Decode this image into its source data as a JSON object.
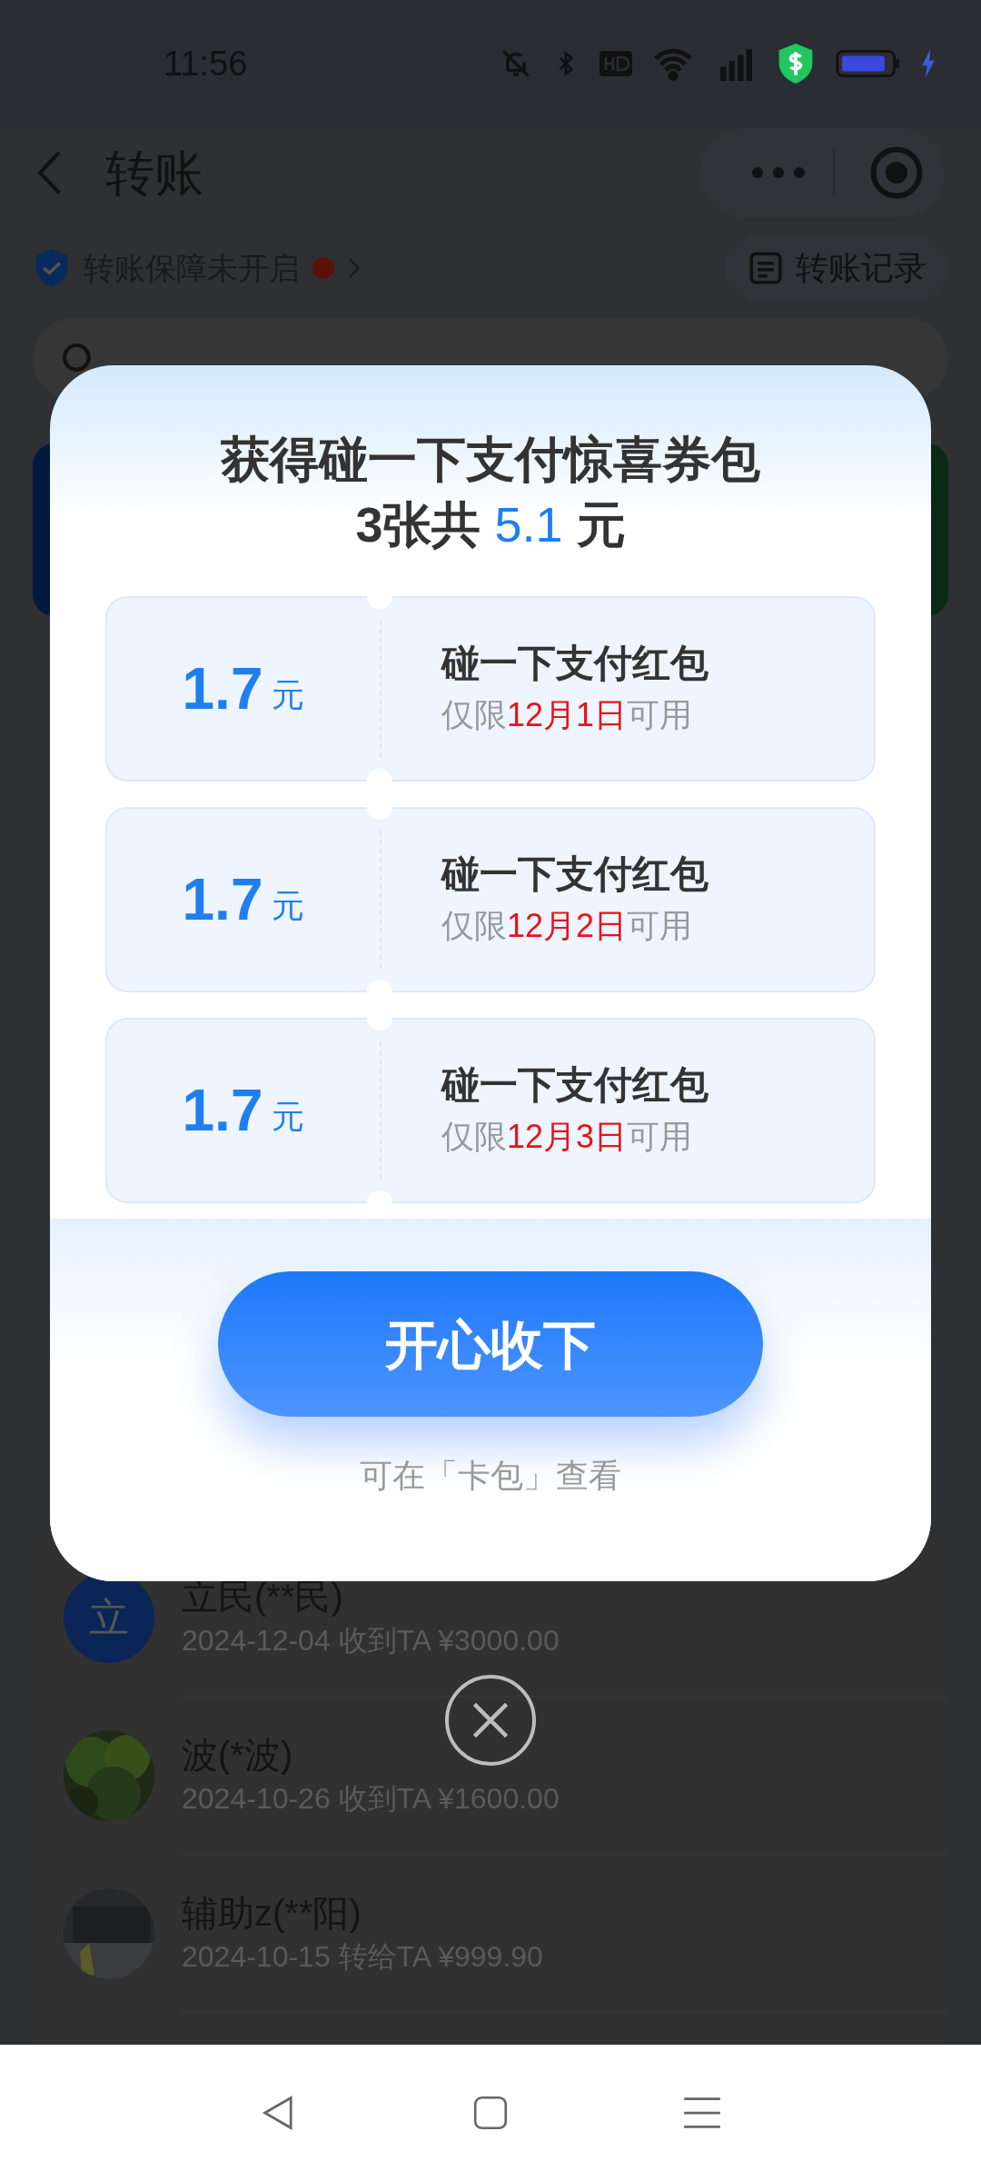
{
  "status_bar": {
    "time": "11:56"
  },
  "header": {
    "title": "转账"
  },
  "protection": {
    "label": "转账保障未开启",
    "records": "转账记录"
  },
  "contacts": [
    {
      "name": "立民(**民)",
      "detail": "2024-12-04 收到TA ¥3000.00",
      "avatar": {
        "kind": "letter",
        "letter": "立"
      }
    },
    {
      "name": "波(*波)",
      "detail": "2024-10-26 收到TA ¥1600.00"
    },
    {
      "name": "辅助z(**阳)",
      "detail": "2024-10-15 转给TA ¥999.90"
    }
  ],
  "modal": {
    "title": "获得碰一下支付惊喜券包",
    "subtitle_prefix": "3张共",
    "subtitle_amount": "5.1",
    "subtitle_suffix": "元",
    "coupons": [
      {
        "amount": "1.7",
        "unit": "元",
        "name": "碰一下支付红包",
        "note_prefix": "仅限",
        "note_date": "12月1日",
        "note_suffix": "可用"
      },
      {
        "amount": "1.7",
        "unit": "元",
        "name": "碰一下支付红包",
        "note_prefix": "仅限",
        "note_date": "12月2日",
        "note_suffix": "可用"
      },
      {
        "amount": "1.7",
        "unit": "元",
        "name": "碰一下支付红包",
        "note_prefix": "仅限",
        "note_date": "12月3日",
        "note_suffix": "可用"
      }
    ],
    "button": "开心收下",
    "hint": "可在「卡包」查看"
  }
}
